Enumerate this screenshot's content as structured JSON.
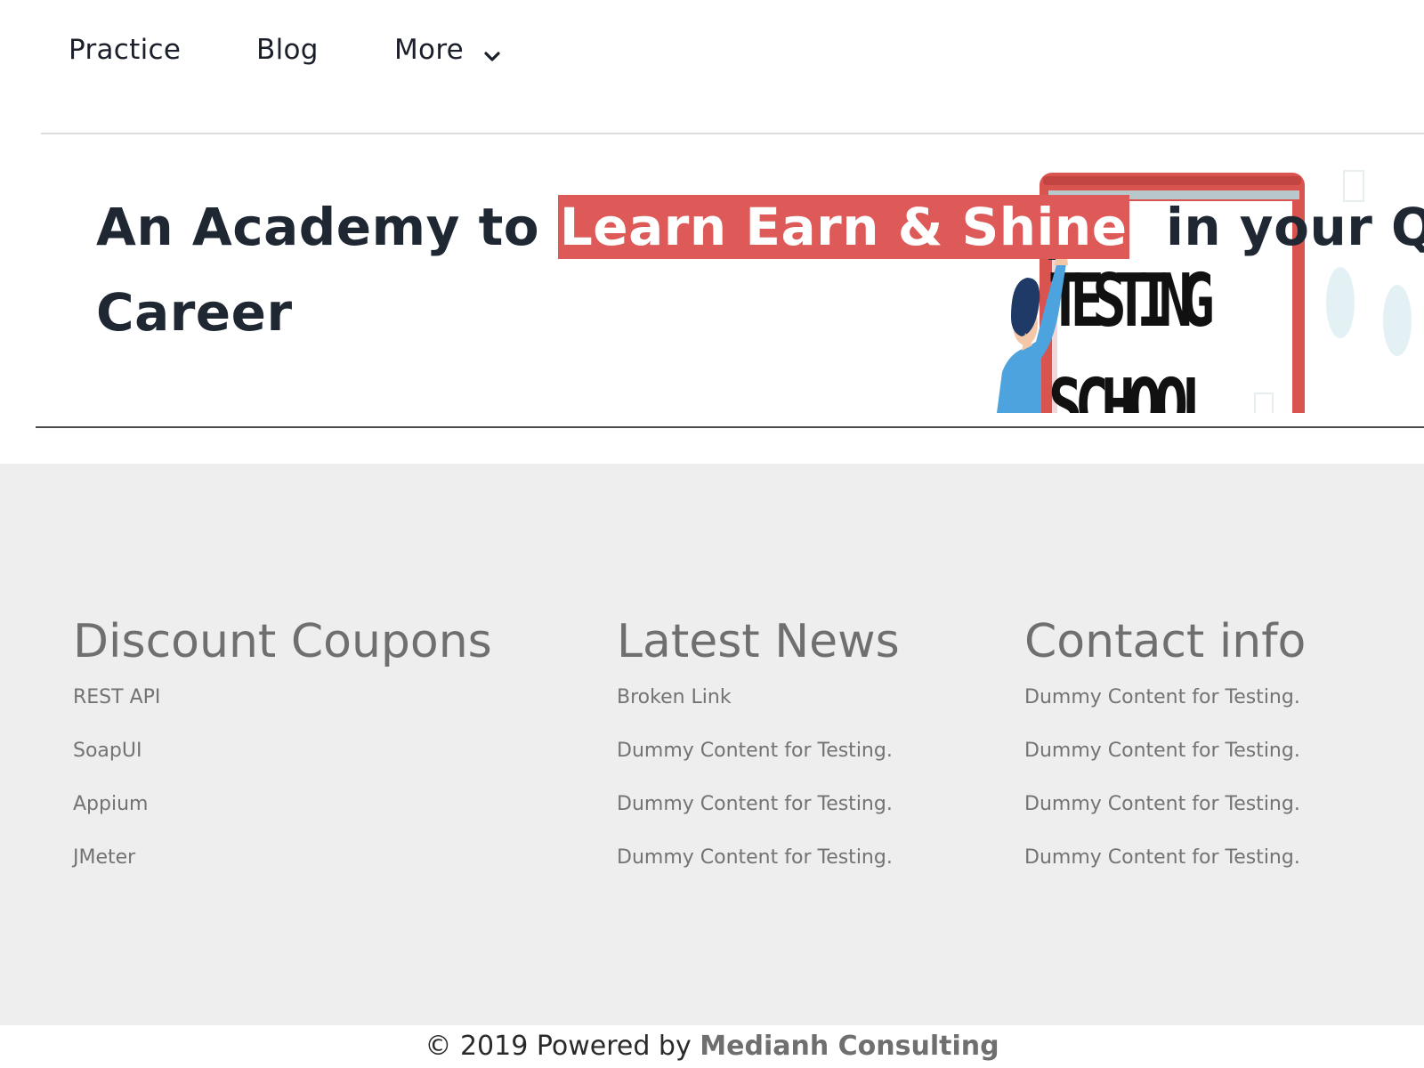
{
  "nav": {
    "items": [
      {
        "label": "Practice"
      },
      {
        "label": "Blog"
      },
      {
        "label": "More",
        "icon": "chevron-down-icon"
      }
    ]
  },
  "hero": {
    "title_before": "An Academy to ",
    "title_highlight": "Learn Earn & Shine",
    "title_after": "  in your QA",
    "title_line2": "Career",
    "highlight_color": "#dd5a58",
    "illustration": {
      "sign_line1": "TESTING",
      "sign_line2": "SCHOOL"
    }
  },
  "footer": {
    "columns": [
      {
        "heading": "Discount Coupons",
        "items": [
          "REST API",
          "SoapUI",
          "Appium",
          "JMeter"
        ]
      },
      {
        "heading": "Latest News",
        "items": [
          "Broken Link",
          "Dummy Content for Testing.",
          "Dummy Content for Testing.",
          "Dummy Content for Testing."
        ]
      },
      {
        "heading": "Contact info",
        "items": [
          "Dummy Content for Testing.",
          "Dummy Content for Testing.",
          "Dummy Content for Testing.",
          "Dummy Content for Testing."
        ]
      }
    ],
    "copyright_prefix": "© 2019 Powered by ",
    "copyright_brand": "Medianh Consulting",
    "background": "#eeeeee"
  }
}
